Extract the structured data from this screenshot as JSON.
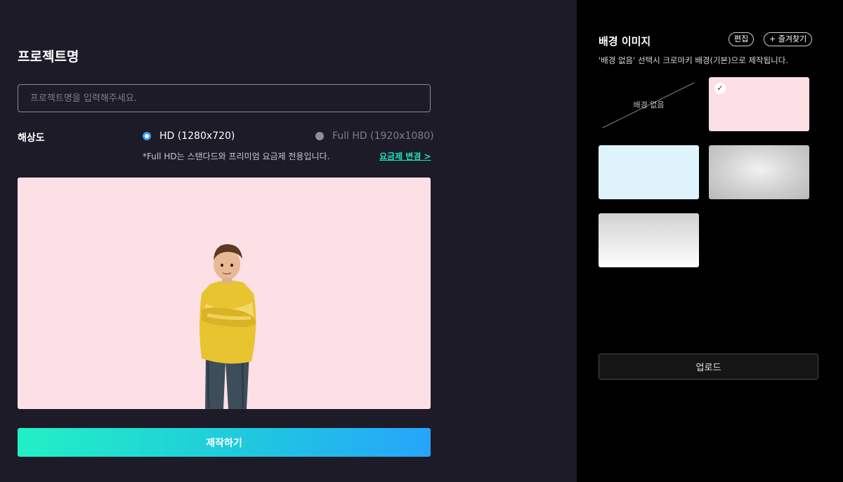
{
  "project": {
    "title": "프로젝트명",
    "name_placeholder": "프로젝트명을 입력해주세요."
  },
  "resolution": {
    "label": "해상도",
    "options": [
      {
        "label": "HD (1280x720)",
        "selected": true
      },
      {
        "label": "Full HD (1920x1080)",
        "selected": false
      }
    ],
    "note": "*Full HD는 스탠다드와 프리미엄 요금제 전용입니다.",
    "plan_link": "요금제 변경 >"
  },
  "make_button": "제작하기",
  "background": {
    "title": "배경 이미지",
    "edit_label": "편집",
    "favorites_label": "+ 즐겨찾기",
    "description": "'배경 없음' 선택시 크로마키 배경(기본)으로 제작됩니다.",
    "none_label": "배경 없음",
    "thumbnails": [
      {
        "id": "none",
        "selected": false
      },
      {
        "id": "pink",
        "color": "#fde0e6",
        "selected": true
      },
      {
        "id": "light-blue",
        "color": "#dff3fd",
        "selected": false
      },
      {
        "id": "grey-radial",
        "color": "#cfcfcf",
        "selected": false
      },
      {
        "id": "silver-gradient",
        "color": "#e8e8e8",
        "selected": false
      }
    ],
    "upload_label": "업로드"
  },
  "colors": {
    "accent_cyan": "#1ee3c4",
    "radio_blue": "#3d9bff",
    "left_bg": "#1c1b27",
    "right_bg": "#000000",
    "preview_bg": "#fde0e6"
  }
}
